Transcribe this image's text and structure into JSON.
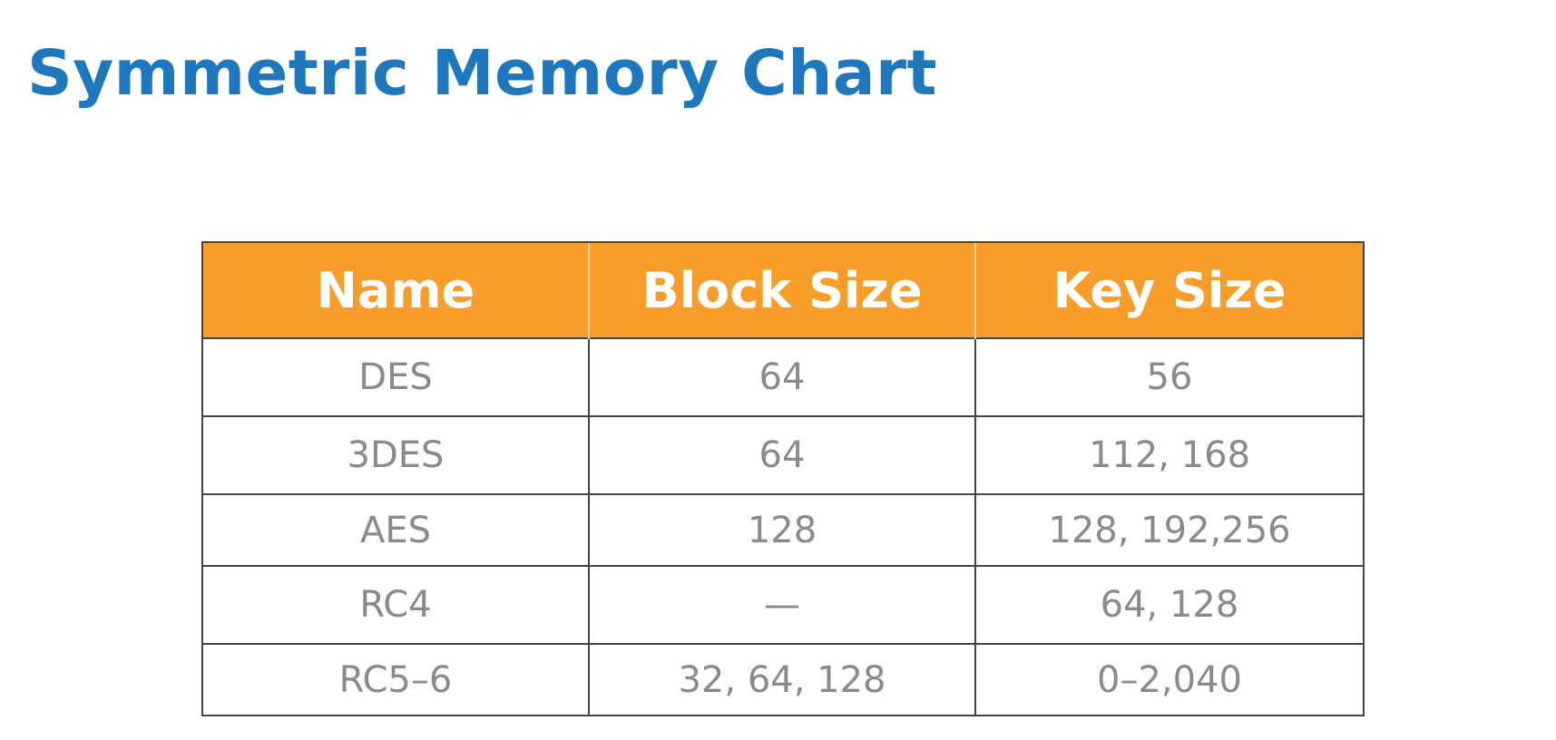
{
  "slide": {
    "title": "Symmetric Memory Chart"
  },
  "colors": {
    "title": "#1f78bd",
    "header_bg": "#f89c2a",
    "header_text": "#ffffff",
    "cell_text": "#8a8a8a",
    "border": "#444444"
  },
  "table": {
    "headers": [
      "Name",
      "Block Size",
      "Key Size"
    ],
    "rows": [
      [
        "DES",
        "64",
        "56"
      ],
      [
        "3DES",
        "64",
        "112, 168"
      ],
      [
        "AES",
        "128",
        "128, 192,256"
      ],
      [
        "RC4",
        "—",
        "64, 128"
      ],
      [
        "RC5–6",
        "32, 64, 128",
        "0–2,040"
      ]
    ]
  }
}
